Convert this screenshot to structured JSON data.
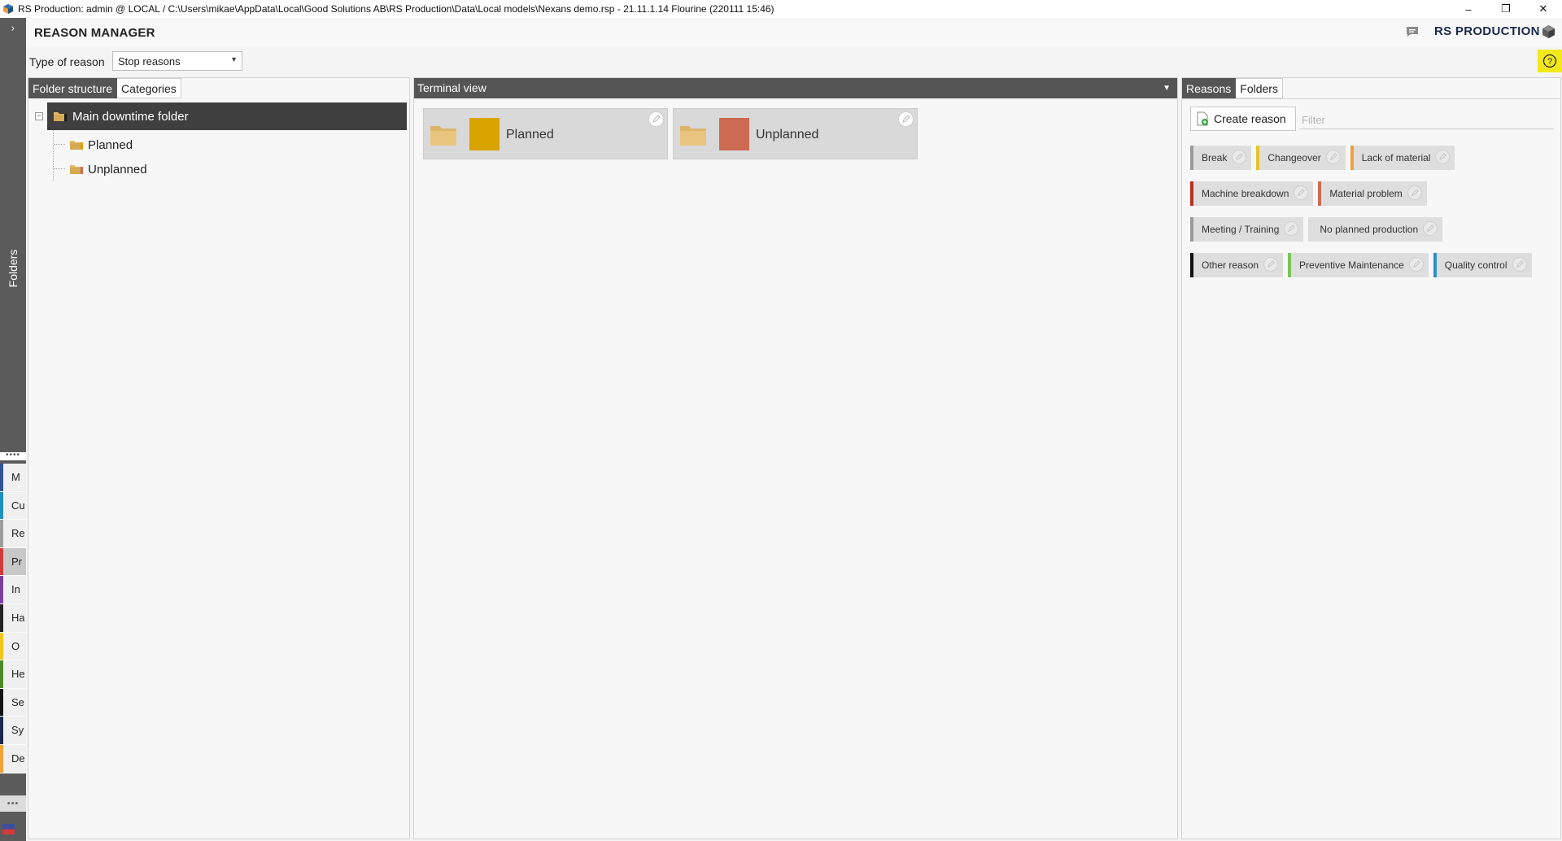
{
  "window": {
    "title": "RS Production: admin @ LOCAL / C:\\Users\\mikae\\AppData\\Local\\Good Solutions AB\\RS Production\\Data\\Local models\\Nexans demo.rsp - 21.11.1.14 Flourine (220111 15:46)",
    "controls": {
      "minimize": "–",
      "restore": "❐",
      "close": "✕"
    }
  },
  "sidebar": {
    "expand_glyph": "›",
    "folders_label": "Folders",
    "dots_top": "••••",
    "dots_bottom": "•••",
    "modules": [
      {
        "label": "M",
        "color": "#2f5597"
      },
      {
        "label": "Cu",
        "color": "#1f8fbf"
      },
      {
        "label": "Re",
        "color": "#9e9e9e"
      },
      {
        "label": "Pr",
        "color": "#d23b3b",
        "active": true
      },
      {
        "label": "In",
        "color": "#7a3fa0"
      },
      {
        "label": "Ha",
        "color": "#222222"
      },
      {
        "label": "O",
        "color": "#f0c419"
      },
      {
        "label": "He",
        "color": "#4f8a2a"
      },
      {
        "label": "Se",
        "color": "#111111"
      },
      {
        "label": "Sy",
        "color": "#1b2a4a"
      },
      {
        "label": "De",
        "color": "#f2a33a"
      }
    ]
  },
  "header": {
    "page_title": "REASON MANAGER",
    "brand": "RS PRODUCTION"
  },
  "filter_bar": {
    "type_label": "Type of reason",
    "type_value": "Stop reasons",
    "help_icon": "?"
  },
  "left_panel": {
    "tabs": [
      "Folder structure",
      "Categories"
    ],
    "active_tab": 0,
    "tree": {
      "root": "Main downtime folder",
      "children": [
        "Planned",
        "Unplanned"
      ]
    }
  },
  "mid_panel": {
    "title": "Terminal view",
    "tiles": [
      {
        "label": "Planned",
        "color": "#d9a300"
      },
      {
        "label": "Unplanned",
        "color": "#cd6a52"
      }
    ]
  },
  "right_panel": {
    "tabs": [
      "Reasons",
      "Folders"
    ],
    "active_tab": 0,
    "create_label": "Create reason",
    "filter_placeholder": "Filter",
    "reasons": [
      [
        {
          "label": "Break",
          "color": "#9a9a9a"
        },
        {
          "label": "Changeover",
          "color": "#e6c229"
        },
        {
          "label": "Lack of material",
          "color": "#f0a13a"
        }
      ],
      [
        {
          "label": "Machine breakdown",
          "color": "#b4331f"
        },
        {
          "label": "Material problem",
          "color": "#c96e55"
        }
      ],
      [
        {
          "label": "Meeting / Training",
          "color": "#9a9a9a"
        },
        {
          "label": "No planned production",
          "color": "#dddddd"
        }
      ],
      [
        {
          "label": "Other reason",
          "color": "#111111"
        },
        {
          "label": "Preventive Maintenance",
          "color": "#7dc45a"
        },
        {
          "label": "Quality control",
          "color": "#2f8fc9"
        }
      ]
    ]
  }
}
